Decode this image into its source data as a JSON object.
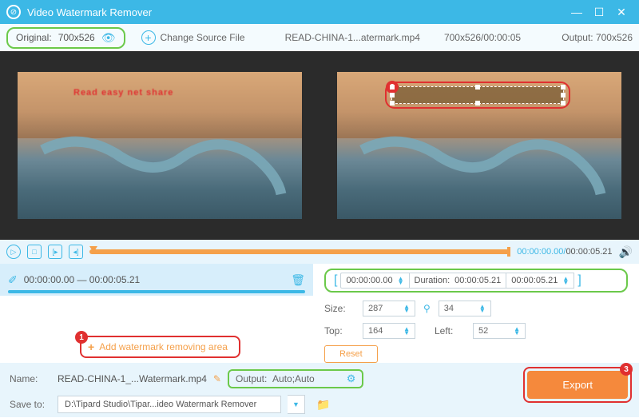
{
  "titlebar": {
    "title": "Video Watermark Remover"
  },
  "toolbar": {
    "original_label": "Original:",
    "original_dim": "700x526",
    "change_source": "Change Source File",
    "filename": "READ-CHINA-1...atermark.mp4",
    "dim_duration": "700x526/00:00:05",
    "output_label": "Output:",
    "output_dim": "700x526"
  },
  "preview": {
    "watermark_text": "Read easy net share",
    "badge2": "2"
  },
  "playbar": {
    "current": "00:00:00.00",
    "duration": "00:00:05.21"
  },
  "segment": {
    "range": "00:00:00.00 — 00:00:05.21",
    "add_label": "Add watermark removing area",
    "badge1": "1"
  },
  "timebox": {
    "start": "00:00:00.00",
    "duration_label": "Duration:",
    "duration_val": "00:00:05.21",
    "end": "00:00:05.21"
  },
  "props": {
    "size_label": "Size:",
    "width": "287",
    "height": "34",
    "top_label": "Top:",
    "top": "164",
    "left_label": "Left:",
    "left": "52",
    "reset": "Reset"
  },
  "bottom": {
    "name_label": "Name:",
    "name_val": "READ-CHINA-1_...Watermark.mp4",
    "output_label": "Output:",
    "output_val": "Auto;Auto",
    "save_label": "Save to:",
    "save_path": "D:\\Tipard Studio\\Tipar...ideo Watermark Remover",
    "export": "Export",
    "badge3": "3"
  }
}
